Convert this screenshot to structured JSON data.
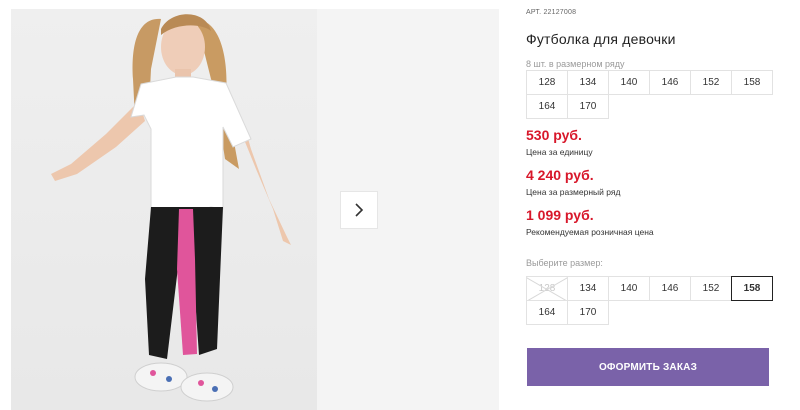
{
  "product": {
    "sku_label": "АРТ.",
    "sku_value": "22127008",
    "title": "Футболка для девочки",
    "pack_note": "8 шт. в размерном ряду"
  },
  "size_range": [
    "128",
    "134",
    "140",
    "146",
    "152",
    "158",
    "164",
    "170"
  ],
  "prices": {
    "unit_price": "530 руб.",
    "unit_label": "Цена за единицу",
    "set_price": "4 240 руб.",
    "set_label": "Цена за размерный ряд",
    "retail_price": "1 099 руб.",
    "retail_label": "Рекомендуемая розничная цена"
  },
  "size_picker": {
    "label": "Выберите размер:",
    "options": [
      {
        "value": "128",
        "state": "unavailable"
      },
      {
        "value": "134",
        "state": "available"
      },
      {
        "value": "140",
        "state": "available"
      },
      {
        "value": "146",
        "state": "available"
      },
      {
        "value": "152",
        "state": "available"
      },
      {
        "value": "158",
        "state": "selected"
      },
      {
        "value": "164",
        "state": "available"
      },
      {
        "value": "170",
        "state": "available"
      }
    ]
  },
  "actions": {
    "order_label": "ОФОРМИТЬ ЗАКАЗ",
    "next_icon": "chevron-right-icon"
  },
  "colors": {
    "price": "#d8172a",
    "order_button": "#7a62a9",
    "pants_stripe": "#e0559b"
  }
}
